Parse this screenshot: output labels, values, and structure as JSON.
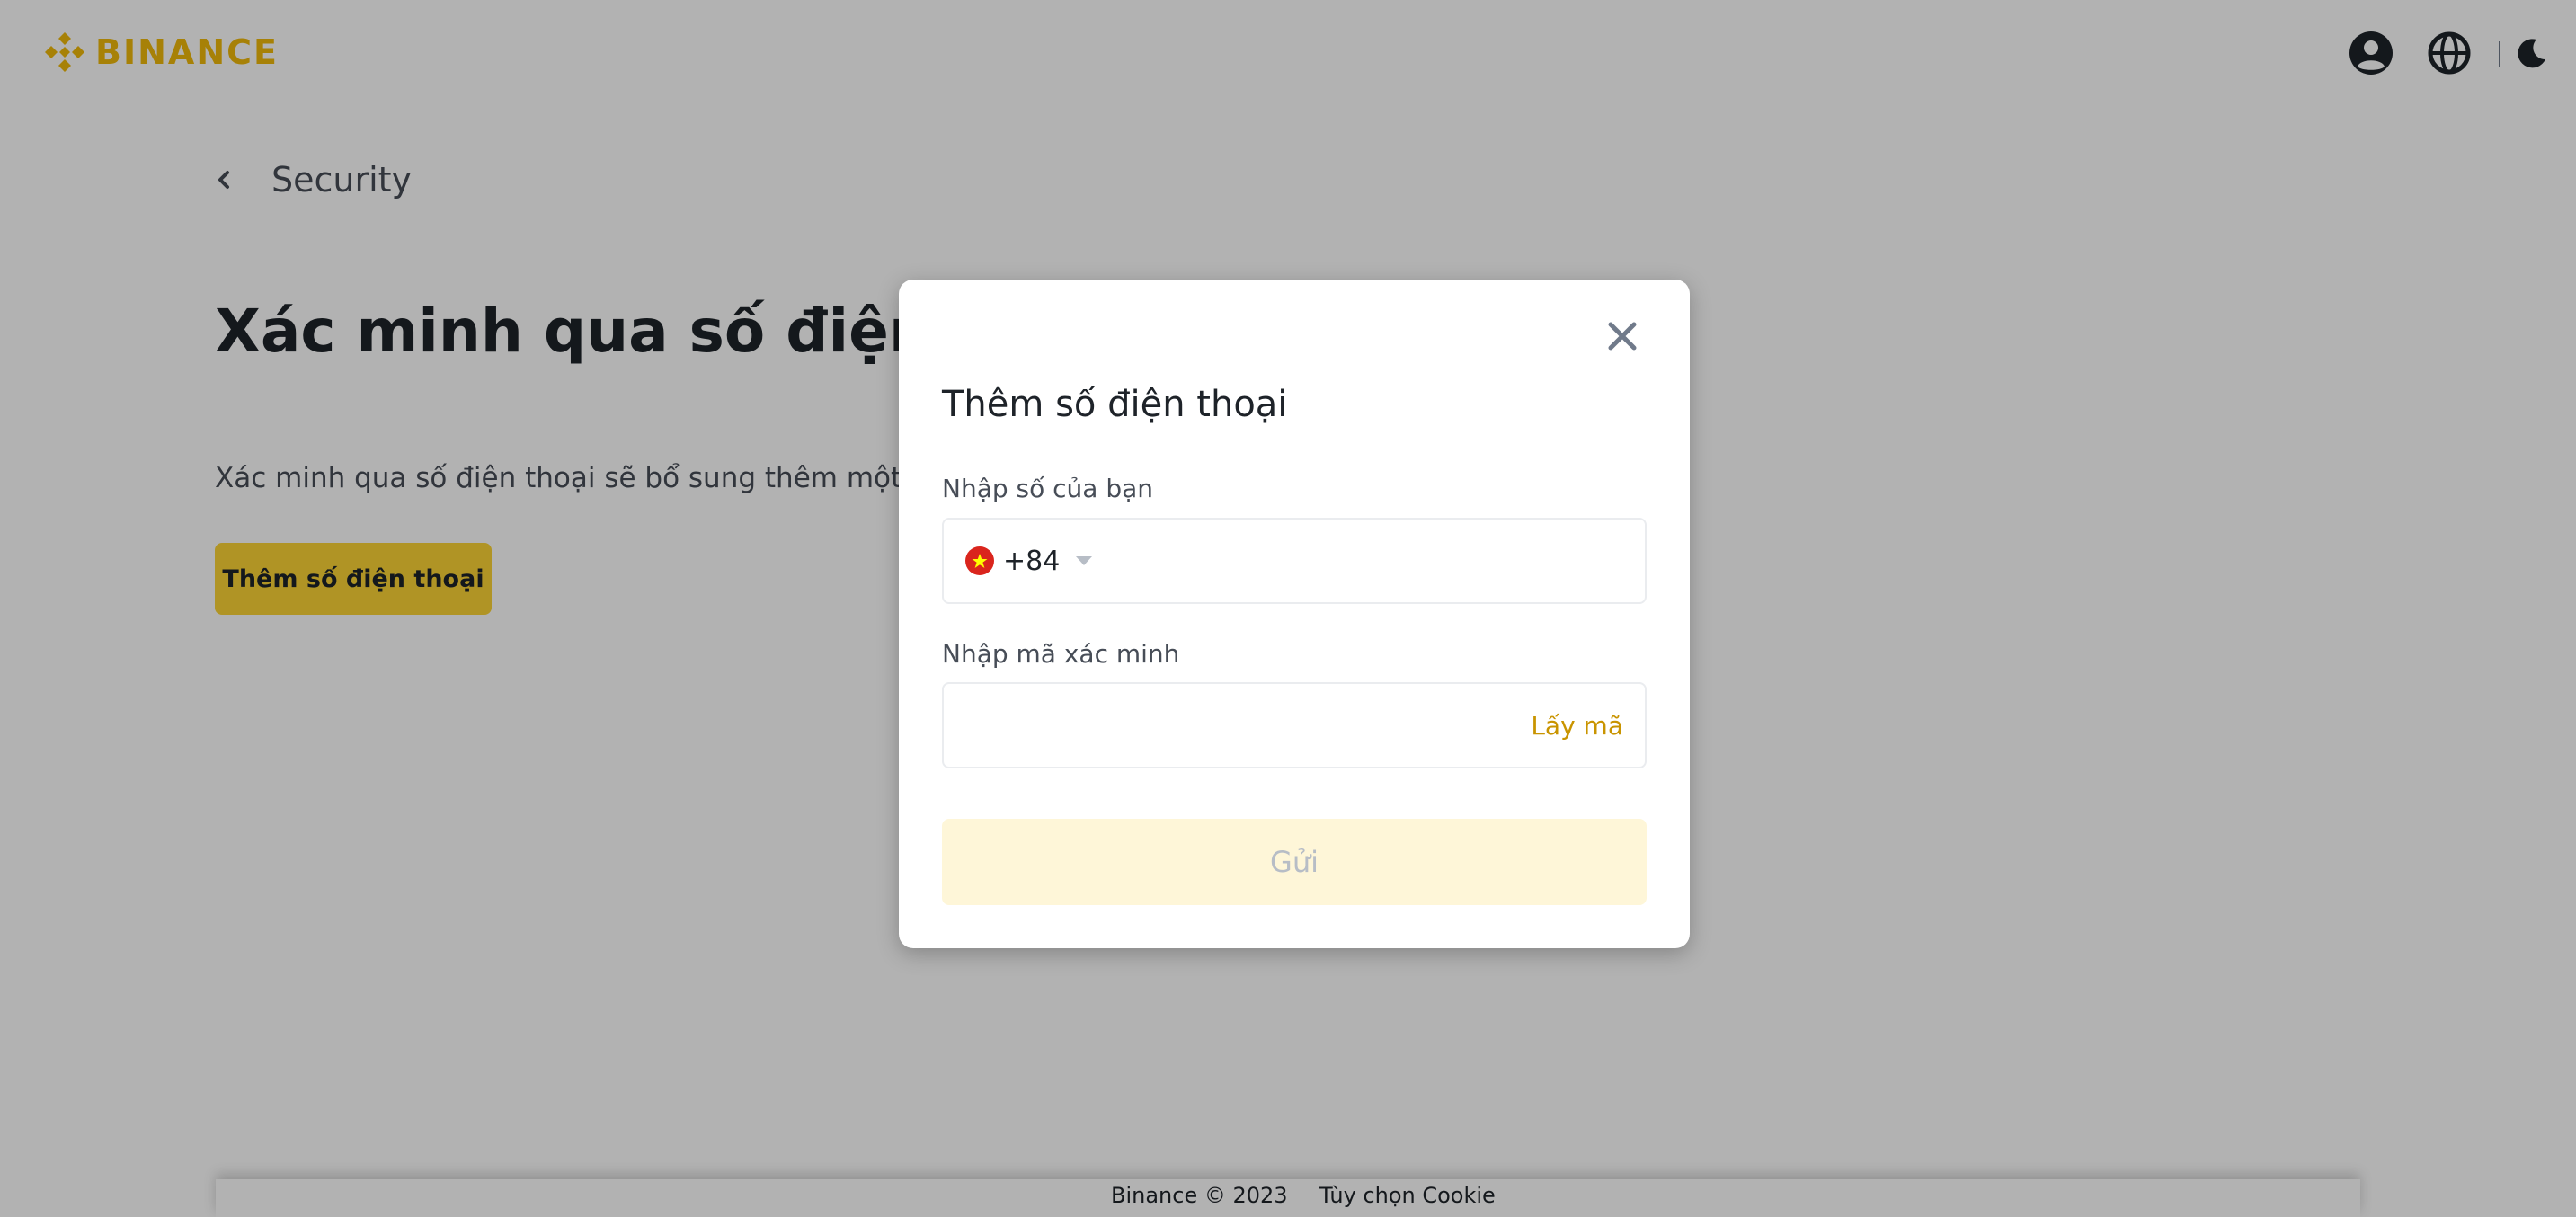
{
  "header": {
    "brand": "BINANCE",
    "brand_color": "#f0b90b",
    "icons": [
      "user-icon",
      "globe-icon",
      "moon-icon"
    ]
  },
  "page": {
    "back_label": "Security",
    "title": "Xác minh qua số điện thoại",
    "description": "Xác minh qua số điện thoại sẽ bổ sung thêm một lớp b",
    "add_phone_button": "Thêm số điện thoại",
    "accent_color": "#fcd535"
  },
  "modal": {
    "title": "Thêm số điện thoại",
    "phone_label": "Nhập số của bạn",
    "country_code": "+84",
    "country_flag": "vietnam-flag-icon",
    "phone_value": "",
    "code_label": "Nhập mã xác minh",
    "code_value": "",
    "get_code_link": "Lấy mã",
    "submit_button": "Gửi"
  },
  "footer": {
    "copyright": "Binance © 2023",
    "cookie_link": "Tùy chọn Cookie"
  }
}
